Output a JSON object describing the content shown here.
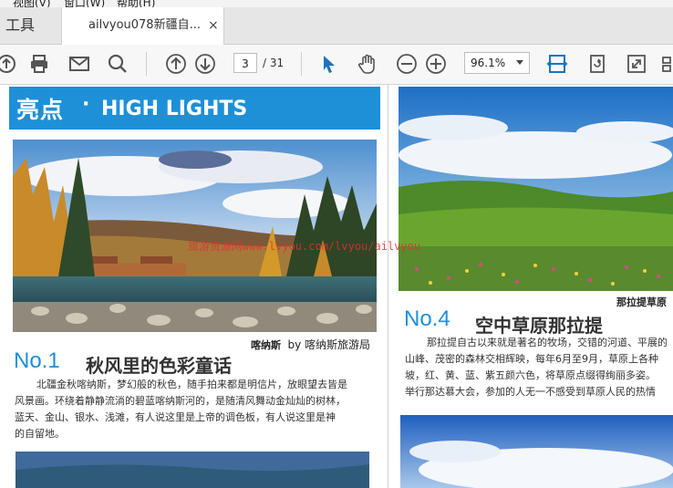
{
  "menubar": {
    "items": [
      "视图(V)",
      "窗口(W)",
      "帮助(H)"
    ]
  },
  "tabs": {
    "tools": "工具",
    "document": "ailvyou078新疆自...",
    "close": "×"
  },
  "toolbar": {
    "page_current": "3",
    "page_total": "/ 31",
    "zoom": "96.1%",
    "icons": [
      "upload-icon",
      "print-icon",
      "mail-icon",
      "search-icon",
      "page-up-icon",
      "page-down-icon",
      "select-cursor-icon",
      "hand-icon",
      "zoom-out-icon",
      "zoom-in-icon",
      "fit-width-icon",
      "rotate-icon",
      "fullscreen-icon"
    ]
  },
  "page": {
    "banner_cn": "亮点",
    "banner_dot": "·",
    "banner_en": "HIGH LIGHTS",
    "watermark": "旅游资源网www.lvyou.com/lvyou/ailvyou",
    "photo1_caption_place": "喀纳斯",
    "photo1_caption_by": "by 喀纳斯旅游局",
    "no1": "No.1",
    "title1": "秋风里的色彩童话",
    "para1": [
      "北疆金秋喀纳斯，梦幻般的秋色，随手拍来都是明信片，放眼望去皆是",
      "风景画。环绕着静静流淌的碧蓝喀纳斯河的，是随清风舞动金灿灿的树林，",
      "蓝天、金山、银水、浅滩，有人说这里是上帝的调色板，有人说这里是神",
      "的自留地。"
    ],
    "photo2_caption_place": "那拉提草原",
    "no4": "No.4",
    "title4": "空中草原那拉提",
    "para4": [
      "那拉提自古以来就是著名的牧场，交错的河道、平展的",
      "山峰、茂密的森林交相辉映，每年6月至9月，草原上各种",
      "坡，红、黄、蓝、紫五颜六色，将草原点缀得绚丽多姿。",
      "举行那达慕大会，参加的人无一不感受到草原人民的热情"
    ]
  },
  "colors": {
    "accent": "#1e90d8",
    "tool_blue": "#1e73be"
  }
}
